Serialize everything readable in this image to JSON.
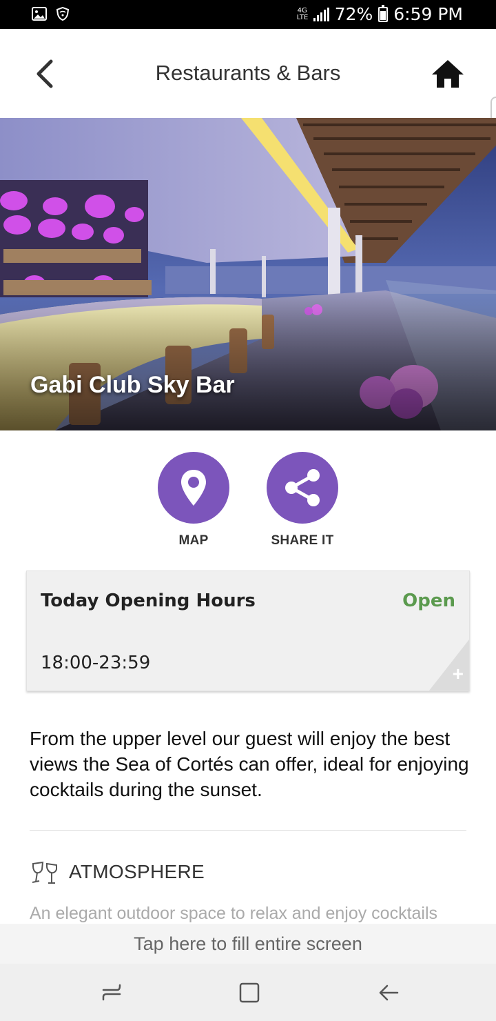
{
  "status_bar": {
    "lte": "4G LTE",
    "battery": "72%",
    "time": "6:59 PM",
    "icons": [
      "gallery-icon",
      "vpn-shield-icon",
      "signal-icon",
      "battery-icon"
    ]
  },
  "header": {
    "title": "Restaurants & Bars",
    "back_icon": "chevron-left-icon",
    "home_icon": "home-icon"
  },
  "hero": {
    "venue_name": "Gabi Club Sky Bar"
  },
  "actions": [
    {
      "label": "MAP",
      "icon": "map-pin-icon"
    },
    {
      "label": "SHARE IT",
      "icon": "share-icon"
    }
  ],
  "hours": {
    "title": "Today Opening Hours",
    "status": "Open",
    "time": "18:00-23:59",
    "expand_icon": "plus-icon"
  },
  "description": "From the upper level our guest will enjoy the best views the Sea of Cortés can offer, ideal for enjoying cocktails during the sunset.",
  "atmosphere": {
    "icon": "wine-glasses-icon",
    "title": "ATMOSPHERE",
    "text": "An elegant outdoor space to relax and enjoy cocktails"
  },
  "fill_screen": "Tap here to fill entire screen",
  "nav": {
    "recent_icon": "recent-apps-icon",
    "home_icon": "home-square-icon",
    "back_icon": "back-arrow-icon"
  },
  "colors": {
    "accent": "#7c55bb",
    "open": "#5b9a4e",
    "card": "#f0f0f0"
  }
}
